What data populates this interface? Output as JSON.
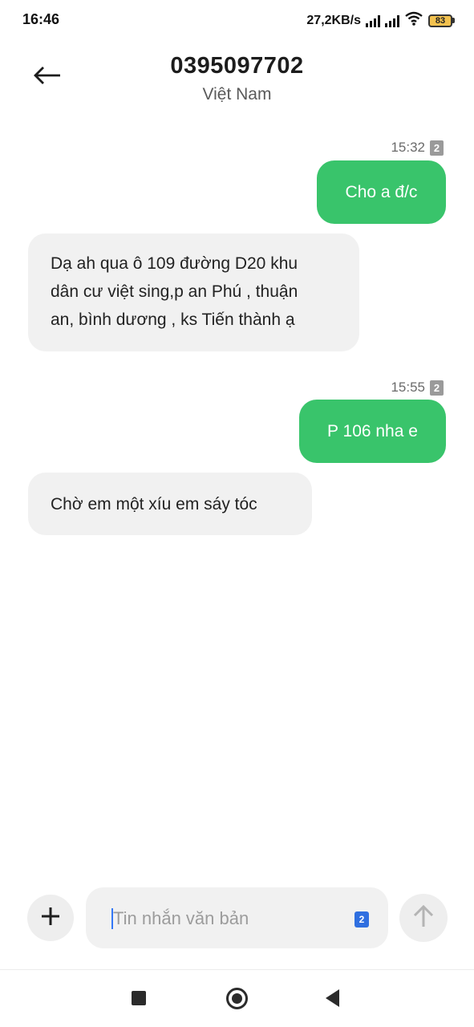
{
  "status_bar": {
    "time": "16:46",
    "network_speed": "27,2KB/s",
    "battery_level": "83",
    "icons": [
      "signal-icon",
      "signal-icon",
      "wifi-icon",
      "battery-icon"
    ]
  },
  "header": {
    "title": "0395097702",
    "subtitle": "Việt Nam",
    "back_icon": "back-arrow-icon"
  },
  "messages": [
    {
      "direction": "outgoing",
      "time": "15:32",
      "sim": "2",
      "text": "Cho a đ/c"
    },
    {
      "direction": "incoming",
      "lines": [
        "Dạ ah qua ô 109 đường D20 khu",
        "dân cư việt sing,p an Phú , thuận",
        "an, bình dương , ks Tiến thành ạ"
      ]
    },
    {
      "direction": "outgoing",
      "time": "15:55",
      "sim": "2",
      "text": "P 106 nha e"
    },
    {
      "direction": "incoming",
      "lines": [
        "Chờ em một xíu em sáy tóc"
      ]
    }
  ],
  "composer": {
    "placeholder": "Tin nhắn văn bản",
    "sim": "2",
    "attach_icon": "plus-icon",
    "send_icon": "send-arrow-icon"
  },
  "nav_bar": {
    "icons": [
      "recent-apps-icon",
      "home-icon",
      "nav-back-icon"
    ]
  },
  "colors": {
    "outgoing_bubble": "#39c46b",
    "incoming_bubble": "#f1f1f1",
    "sim_select": "#2f6fe0"
  }
}
